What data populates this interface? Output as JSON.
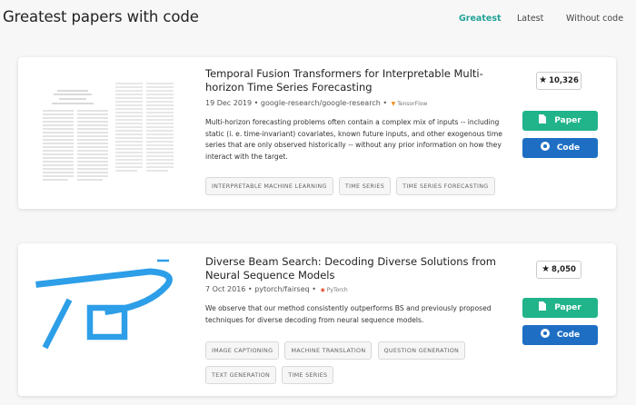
{
  "header": {
    "title": "Greatest papers with code",
    "nav": [
      "Greatest",
      "Latest",
      "Without code"
    ]
  },
  "papers": [
    {
      "title": "Temporal Fusion Transformers for Interpretable Multi-horizon Time Series Forecasting",
      "date": "19 Dec 2019",
      "repo": "google-research/google-research",
      "framework": "TensorFlow",
      "abstract": "Multi-horizon forecasting problems often contain a complex mix of inputs -- including static (i. e. time-invariant) covariates, known future inputs, and other exogenous time series that are only observed historically -- without any prior information on how they interact with the target.",
      "tags": [
        "INTERPRETABLE MACHINE LEARNING",
        "TIME SERIES",
        "TIME SERIES FORECASTING"
      ],
      "stars": "10,326",
      "paper_label": "Paper",
      "code_label": "Code"
    },
    {
      "title": "Diverse Beam Search: Decoding Diverse Solutions from Neural Sequence Models",
      "date": "7 Oct 2016",
      "repo": "pytorch/fairseq",
      "framework": "PyTorch",
      "abstract": "We observe that our method consistently outperforms BS and previously proposed techniques for diverse decoding from neural sequence models.",
      "tags": [
        "IMAGE CAPTIONING",
        "MACHINE TRANSLATION",
        "QUESTION GENERATION",
        "TEXT GENERATION",
        "TIME SERIES"
      ],
      "stars": "8,050",
      "paper_label": "Paper",
      "code_label": "Code"
    }
  ],
  "colors": {
    "active_nav": "#21a398",
    "paper_button": "#21b48b",
    "code_button": "#1e6fc4",
    "thumbnail_accent": "#2d9ee8"
  }
}
